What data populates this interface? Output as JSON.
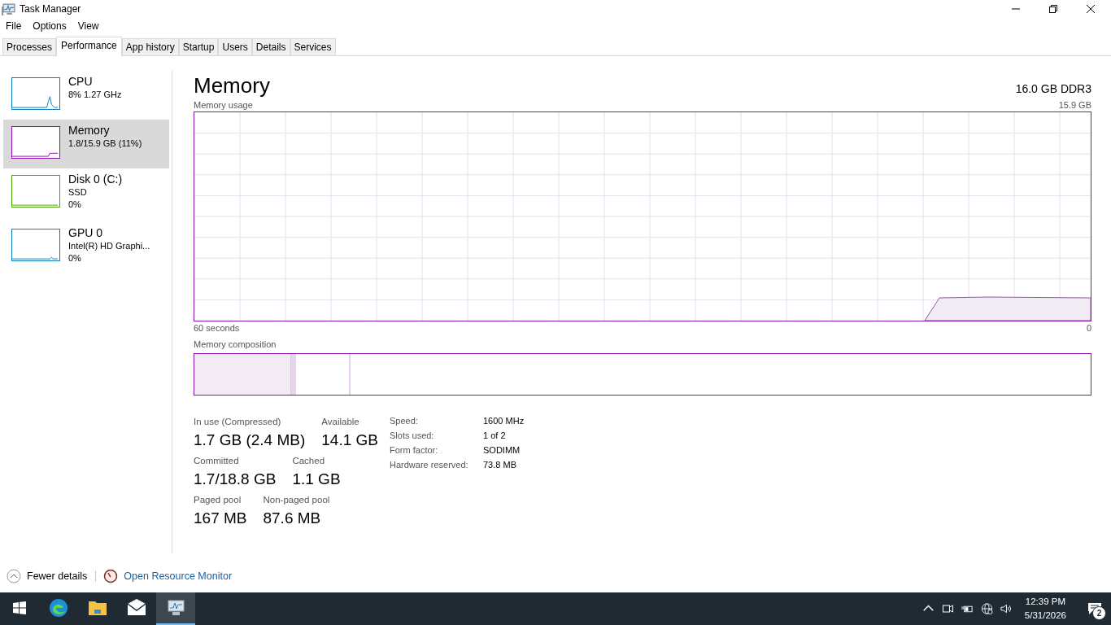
{
  "window": {
    "title": "Task Manager"
  },
  "menu": [
    "File",
    "Options",
    "View"
  ],
  "tabs": [
    {
      "label": "Processes",
      "selected": false
    },
    {
      "label": "Performance",
      "selected": true
    },
    {
      "label": "App history",
      "selected": false
    },
    {
      "label": "Startup",
      "selected": false
    },
    {
      "label": "Users",
      "selected": false
    },
    {
      "label": "Details",
      "selected": false
    },
    {
      "label": "Services",
      "selected": false
    }
  ],
  "sidebar": {
    "items": [
      {
        "kind": "cpu",
        "name": "CPU",
        "lines": [
          "8%  1.27 GHz"
        ],
        "color": "#117dbb",
        "selected": false
      },
      {
        "kind": "memory",
        "name": "Memory",
        "lines": [
          "1.8/15.9 GB (11%)"
        ],
        "color": "#8b12ae",
        "selected": true
      },
      {
        "kind": "disk",
        "name": "Disk 0 (C:)",
        "lines": [
          "SSD",
          "0%"
        ],
        "color": "#4da60c",
        "selected": false
      },
      {
        "kind": "gpu",
        "name": "GPU 0",
        "lines": [
          "Intel(R) HD Graphi...",
          "0%"
        ],
        "color": "#117dbb",
        "selected": false
      }
    ]
  },
  "memory": {
    "title": "Memory",
    "spec": "16.0 GB DDR3",
    "usage_label": "Memory usage",
    "usage_max": "15.9 GB",
    "time_span": "60 seconds",
    "time_end": "0",
    "composition_label": "Memory composition",
    "stats": [
      [
        {
          "label": "In use (Compressed)",
          "value": "1.7 GB (2.4 MB)"
        },
        {
          "label": "Available",
          "value": "14.1 GB"
        }
      ],
      [
        {
          "label": "Committed",
          "value": "1.7/18.8 GB"
        },
        {
          "label": "Cached",
          "value": "1.1 GB"
        }
      ],
      [
        {
          "label": "Paged pool",
          "value": "167 MB"
        },
        {
          "label": "Non-paged pool",
          "value": "87.6 MB"
        }
      ]
    ],
    "details": [
      {
        "label": "Speed:",
        "value": "1600 MHz"
      },
      {
        "label": "Slots used:",
        "value": "1 of 2"
      },
      {
        "label": "Form factor:",
        "value": "SODIMM"
      },
      {
        "label": "Hardware reserved:",
        "value": "73.8 MB"
      }
    ]
  },
  "footer": {
    "fewer_details": "Fewer details",
    "resource_monitor": "Open Resource Monitor"
  },
  "taskbar": {
    "apps": [
      {
        "kind": "edge",
        "selected": false
      },
      {
        "kind": "folder",
        "selected": false
      },
      {
        "kind": "mail",
        "selected": false
      },
      {
        "kind": "taskmanager",
        "selected": true
      }
    ],
    "time": "12:39 PM",
    "date": "5/31/2026",
    "notifications": "2"
  }
}
